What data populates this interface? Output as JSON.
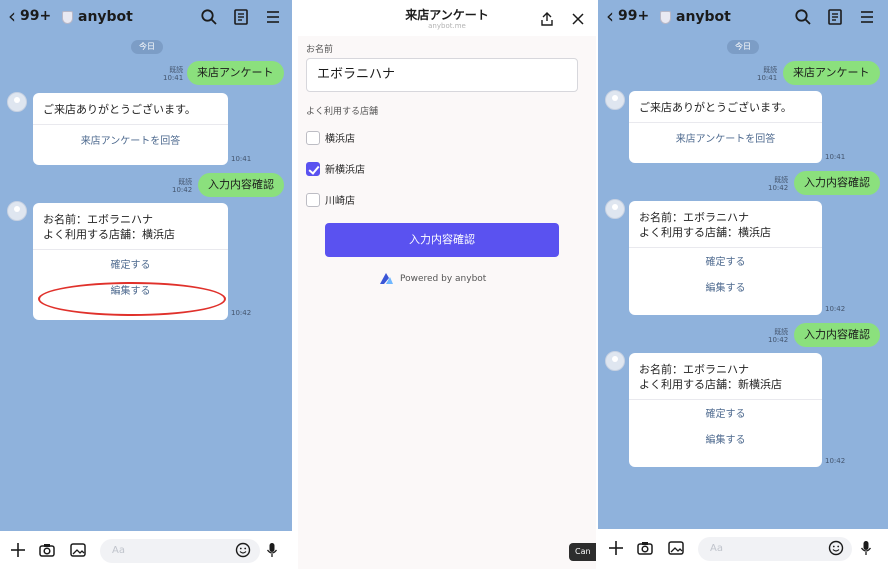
{
  "left_chat": {
    "back_count": "99+",
    "title": "anybot",
    "date": "今日",
    "messages": {
      "out1": {
        "text": "来店アンケート",
        "read": "既読",
        "time": "10:41"
      },
      "card1": {
        "text": "ご来店ありがとうございます。",
        "action": "来店アンケートを回答",
        "time": "10:41"
      },
      "out2": {
        "text": "入力内容確認",
        "read": "既読",
        "time": "10:42"
      },
      "card2": {
        "line1": "お名前：エボラニハナ",
        "line2": "よく利用する店舗：横浜店",
        "confirm": "確定する",
        "edit": "編集する",
        "time": "10:42"
      }
    },
    "composer_placeholder": "Aa"
  },
  "survey": {
    "title": "来店アンケート",
    "url": "anybot.me",
    "name_label": "お名前",
    "name_value": "エボラニハナ",
    "store_label": "よく利用する店舗",
    "options": [
      {
        "label": "横浜店",
        "checked": false
      },
      {
        "label": "新横浜店",
        "checked": true
      },
      {
        "label": "川崎店",
        "checked": false
      }
    ],
    "confirm_label": "入力内容確認",
    "powered": "Powered by anybot",
    "cutoff_text": "Can"
  },
  "right_chat": {
    "back_count": "99+",
    "title": "anybot",
    "date": "今日",
    "messages": {
      "out1": {
        "text": "来店アンケート",
        "read": "既読",
        "time": "10:41"
      },
      "card1": {
        "text": "ご来店ありがとうございます。",
        "action": "来店アンケートを回答",
        "time": "10:41"
      },
      "out2": {
        "text": "入力内容確認",
        "read": "既読",
        "time": "10:42"
      },
      "card2": {
        "line1": "お名前：エボラニハナ",
        "line2": "よく利用する店舗：横浜店",
        "confirm": "確定する",
        "edit": "編集する",
        "time": "10:42"
      },
      "out3": {
        "text": "入力内容確認",
        "read": "既読",
        "time": "10:42"
      },
      "card3": {
        "line1": "お名前：エボラニハナ",
        "line2": "よく利用する店舗：新横浜店",
        "confirm": "確定する",
        "edit": "編集する",
        "time": "10:42"
      }
    },
    "composer_placeholder": "Aa"
  },
  "colors": {
    "chat_bg": "#8fb2dc",
    "outgoing_bubble": "#8be07d",
    "accent": "#5a52f0",
    "highlight": "#e0312b"
  }
}
